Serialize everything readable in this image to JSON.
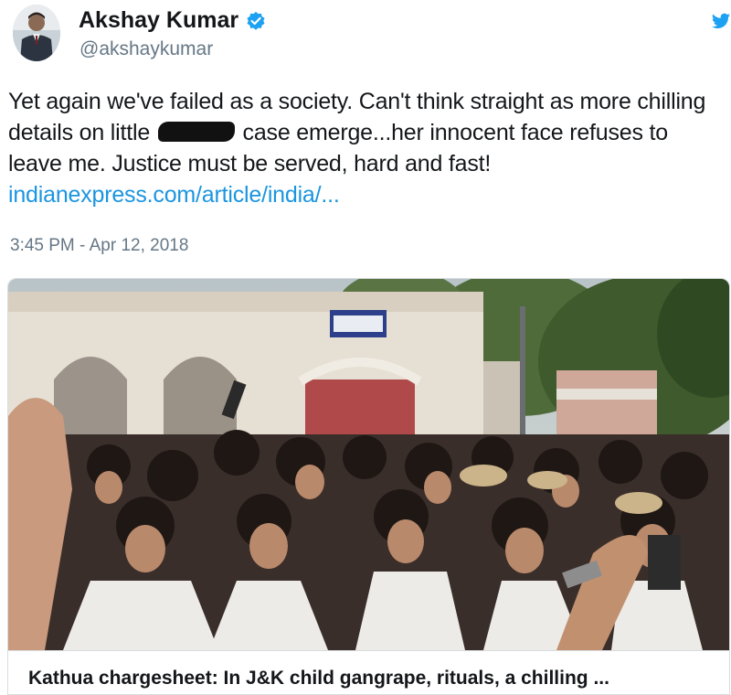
{
  "user": {
    "display_name": "Akshay Kumar",
    "handle": "@akshaykumar",
    "verified": true,
    "avatar_icon": "profile-photo"
  },
  "platform_icon": "twitter-bird-icon",
  "tweet": {
    "text_before_redaction": "Yet again we've failed as a society. Can't think straight as more chilling details on little",
    "text_after_redaction": "case emerge...her innocent face refuses to leave me. Justice must be served, hard and fast!",
    "link": "indianexpress.com/article/india/...",
    "timestamp": "3:45 PM - Apr 12, 2018"
  },
  "card": {
    "title": "Kathua chargesheet: In J&K child gangrape, rituals, a chilling ..."
  },
  "colors": {
    "link": "#1b95e0",
    "verified_badge": "#1da1f2",
    "secondary_text": "#657786"
  }
}
